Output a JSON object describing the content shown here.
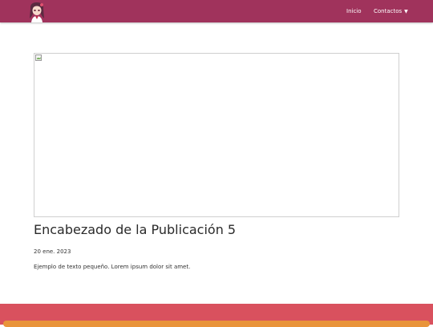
{
  "navbar": {
    "logo_icon": "anime-girl-avatar-logo",
    "links": [
      {
        "label": "Inicio"
      },
      {
        "label": "Contactos",
        "icon": "caret-down-icon"
      }
    ],
    "background": "#a0335c"
  },
  "post": {
    "image_icon": "broken-image-icon",
    "title": "Encabezado de la Publicación 5",
    "date": "20 ene. 2023",
    "excerpt": "Ejemplo de texto pequeño. Lorem ipsum dolor sit amet."
  },
  "footer": {
    "background": "#d9515e",
    "accent": "#e9943a"
  }
}
